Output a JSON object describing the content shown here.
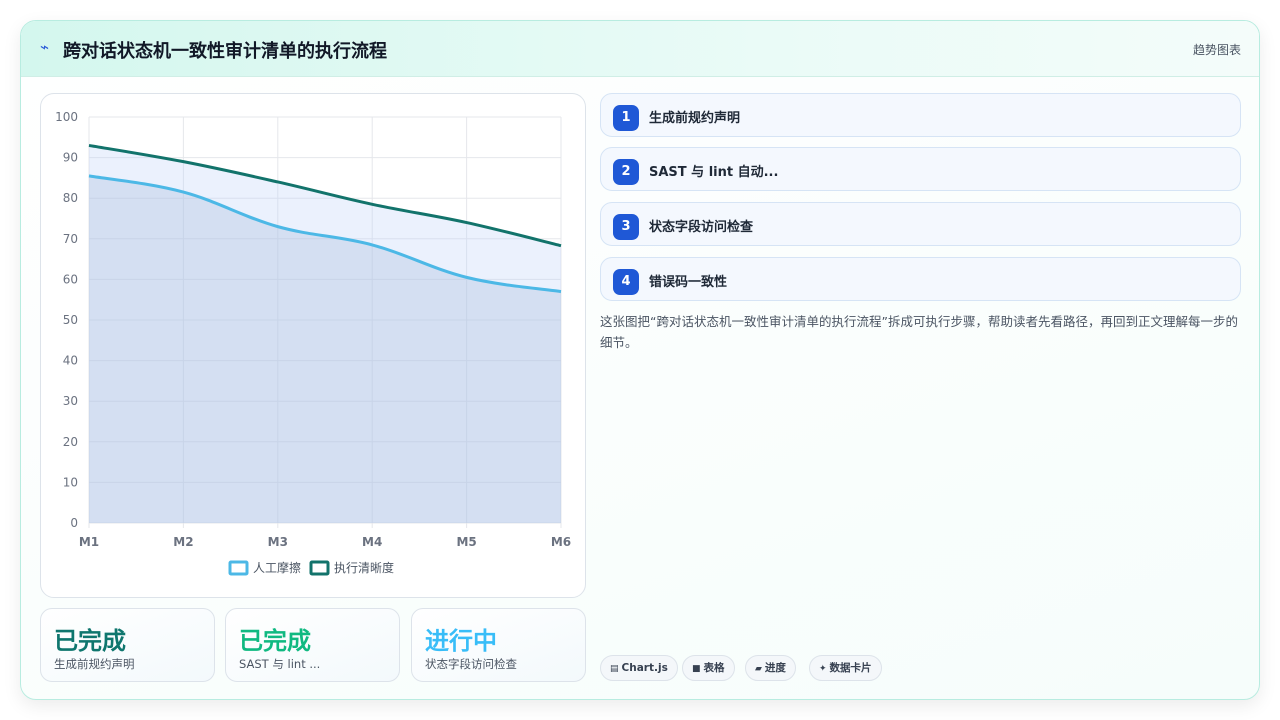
{
  "header": {
    "icon": "lightning-icon",
    "title": "跨对话状态机一致性审计清单的执行流程",
    "tag": "趋势图表"
  },
  "steps": [
    {
      "num": "1",
      "label": "生成前规约声明"
    },
    {
      "num": "2",
      "label": "SAST 与 lint 自动..."
    },
    {
      "num": "3",
      "label": "状态字段访问检查"
    },
    {
      "num": "4",
      "label": "错误码一致性"
    }
  ],
  "description": "这张图把“跨对话状态机一致性审计清单的执行流程”拆成可执行步骤，帮助读者先看路径，再回到正文理解每一步的细节。",
  "status_cards": [
    {
      "big": "已完成",
      "small": "生成前规约声明",
      "color": "#0f766e"
    },
    {
      "big": "已完成",
      "small": "SAST 与 lint ...",
      "color": "#10b981"
    },
    {
      "big": "进行中",
      "small": "状态字段访问检查",
      "color": "#38bdf8"
    }
  ],
  "chips": [
    {
      "icon": "chart-icon",
      "glyph": "▤",
      "label": "Chart.js"
    },
    {
      "icon": "table-icon",
      "glyph": "■",
      "label": "表格"
    },
    {
      "icon": "progress-icon",
      "glyph": "▰",
      "label": "进度"
    },
    {
      "icon": "sparkle-icon",
      "glyph": "✦",
      "label": "数据卡片"
    }
  ],
  "chart_data": {
    "type": "line",
    "categories": [
      "M1",
      "M2",
      "M3",
      "M4",
      "M5",
      "M6"
    ],
    "ylim": [
      0,
      100
    ],
    "yticks": [
      0,
      10,
      20,
      30,
      40,
      50,
      60,
      70,
      80,
      90,
      100
    ],
    "grid": true,
    "legend": "bottom",
    "series": [
      {
        "name": "人工摩擦",
        "values": [
          85.5,
          81.5,
          73,
          68.5,
          60.5,
          57
        ],
        "color": "#4cb8e6",
        "fill": "rgba(170,190,220,0.35)"
      },
      {
        "name": "执行清晰度",
        "values": [
          93,
          89,
          84,
          78.5,
          74,
          68.3
        ],
        "color": "#12736b",
        "fill": "rgba(190,210,250,0.30)"
      }
    ]
  }
}
